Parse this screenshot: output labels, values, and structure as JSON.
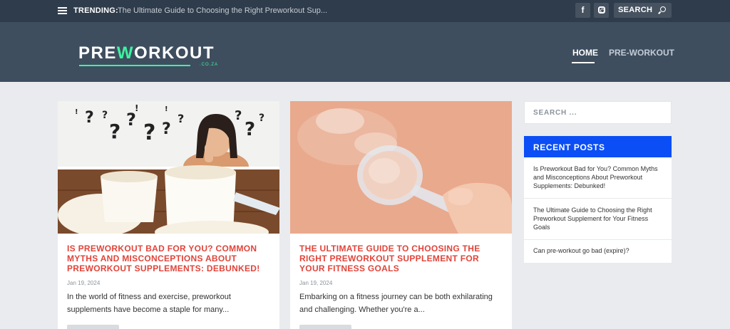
{
  "topbar": {
    "trending_label": "TRENDING:",
    "trending_text": "The Ultimate Guide to Choosing the Right Preworkout Sup...",
    "facebook_label": "f",
    "search_label": "SEARCH"
  },
  "header": {
    "logo_pre": "PRE",
    "logo_accent": "W",
    "logo_post": "ORKOUT",
    "logo_sub": ".CO.ZA",
    "nav": [
      "HOME",
      "PRE-WORKOUT"
    ]
  },
  "posts": [
    {
      "title": "IS PREWORKOUT BAD FOR YOU? COMMON MYTHS AND MISCONCEPTIONS ABOUT PREWORKOUT SUPPLEMENTS: DEBUNKED!",
      "date": "Jan 19, 2024",
      "excerpt": "In the world of fitness and exercise, preworkout supplements have become a staple for many..."
    },
    {
      "title": "THE ULTIMATE GUIDE TO CHOOSING THE RIGHT PREWORKOUT SUPPLEMENT FOR YOUR FITNESS GOALS",
      "date": "Jan 19, 2024",
      "excerpt": "Embarking on a fitness journey can be both exhilarating and challenging. Whether you're a..."
    }
  ],
  "sidebar": {
    "search_placeholder": "SEARCH ...",
    "recent_title": "RECENT POSTS",
    "recent": [
      "Is Preworkout Bad for You? Common Myths and Misconceptions About Preworkout Supplements: Debunked!",
      "The Ultimate Guide to Choosing the Right Preworkout Supplement for Your Fitness Goals",
      "Can pre-workout go bad (expire)?"
    ]
  },
  "colors": {
    "topbar_bg": "#2f3c4b",
    "header_bg": "#3e4e5f",
    "logo_accent": "#3ef2a0",
    "post_title": "#e0443a",
    "recent_head": "#0b4ef6",
    "page_bg": "#e9ebee"
  },
  "icons": [
    "menu-icon",
    "facebook-icon",
    "instagram-icon",
    "search-icon"
  ]
}
